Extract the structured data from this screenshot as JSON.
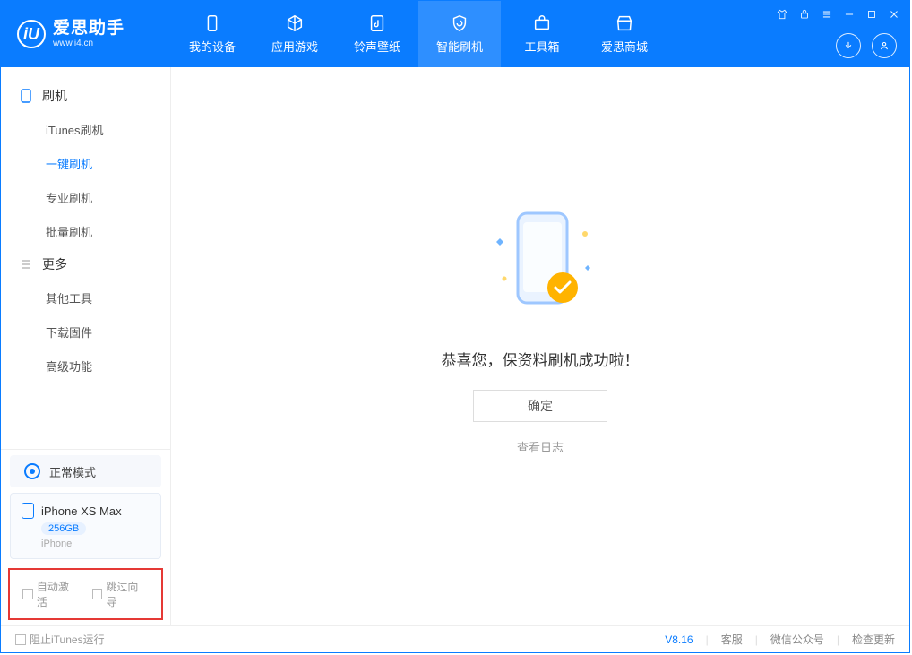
{
  "logo": {
    "title": "爱思助手",
    "subtitle": "www.i4.cn"
  },
  "tabs": {
    "device": "我的设备",
    "apps": "应用游戏",
    "ring": "铃声壁纸",
    "flash": "智能刷机",
    "tools": "工具箱",
    "store": "爱思商城"
  },
  "sidebar": {
    "group1": "刷机",
    "itunes": "iTunes刷机",
    "oneclick": "一键刷机",
    "pro": "专业刷机",
    "batch": "批量刷机",
    "group2": "更多",
    "other": "其他工具",
    "firmware": "下载固件",
    "adv": "高级功能"
  },
  "mode": "正常模式",
  "device": {
    "name": "iPhone XS Max",
    "capacity": "256GB",
    "type": "iPhone"
  },
  "options": {
    "auto_activate": "自动激活",
    "skip_guide": "跳过向导"
  },
  "main": {
    "message": "恭喜您，保资料刷机成功啦！",
    "ok": "确定",
    "log": "查看日志"
  },
  "footer": {
    "block_itunes": "阻止iTunes运行",
    "version": "V8.16",
    "support": "客服",
    "wechat": "微信公众号",
    "update": "检查更新"
  }
}
